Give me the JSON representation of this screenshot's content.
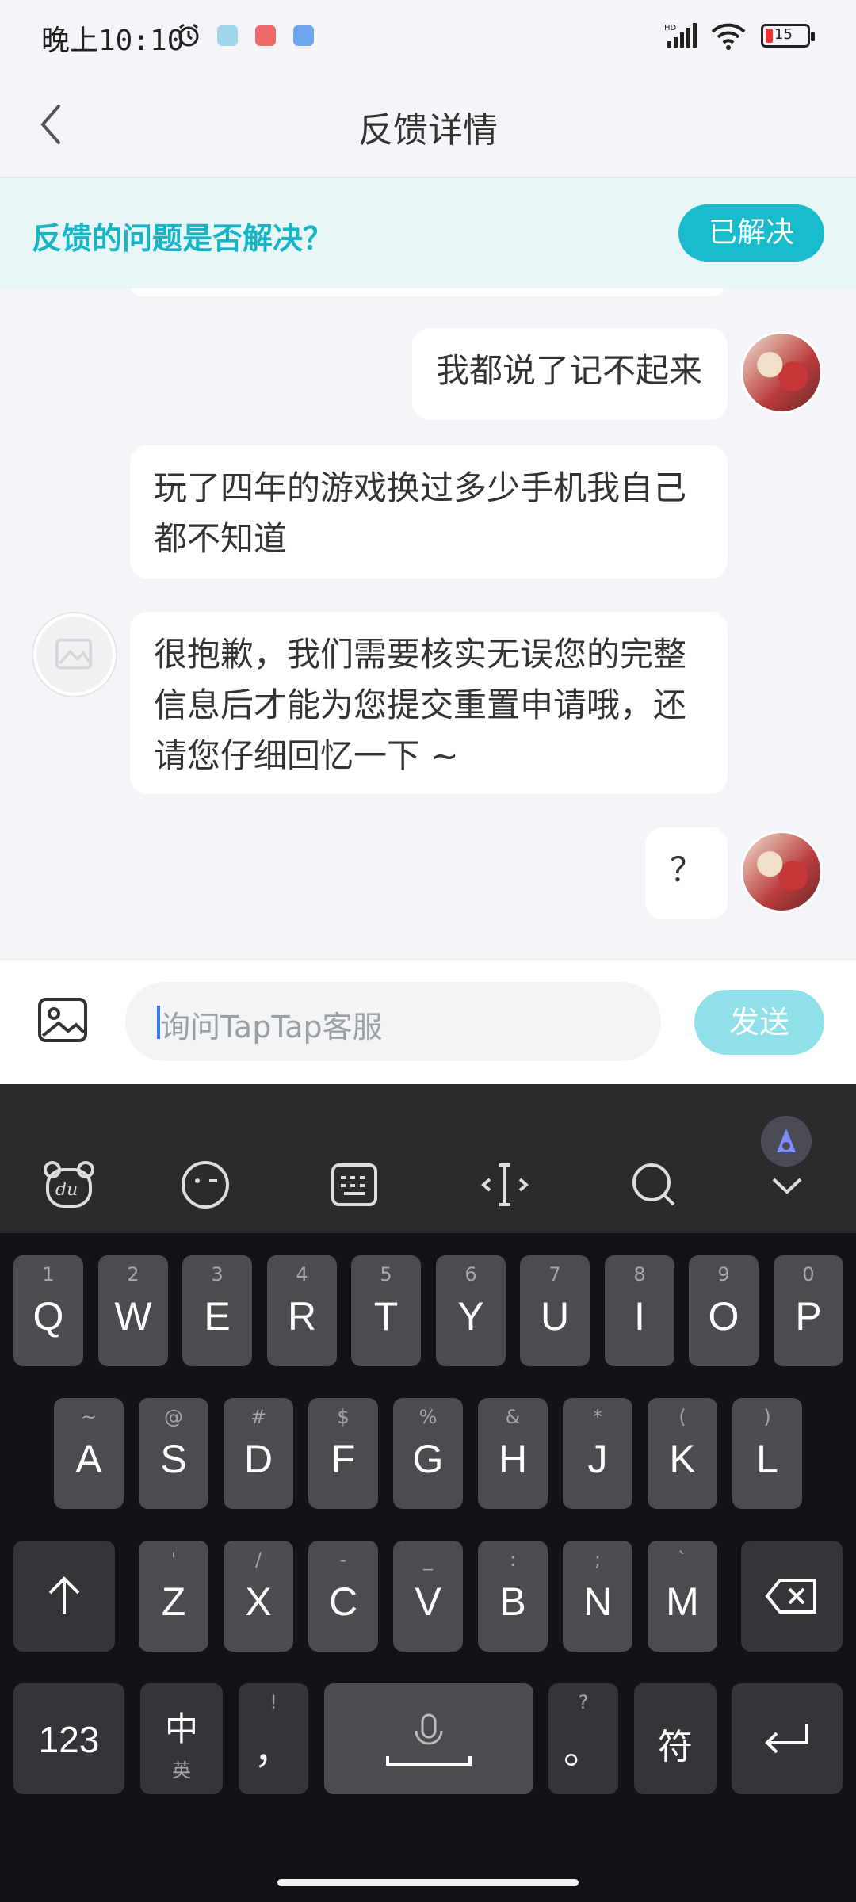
{
  "status_bar": {
    "time": "晚上10:10",
    "battery": "15"
  },
  "header": {
    "title": "反馈详情"
  },
  "banner": {
    "question": "反馈的问题是否解决？",
    "button": "已解决"
  },
  "messages": [
    {
      "from": "user",
      "text": "我都说了记不起来"
    },
    {
      "from": "support",
      "lines": [
        "玩了四年的游戏换过多少手机我自己",
        "都不知道"
      ]
    },
    {
      "from": "support",
      "lines": [
        "很抱歉，我们需要核实无误您的完整",
        "信息后才能为您提交重置申请哦，还",
        "请您仔细回忆一下 ~"
      ]
    },
    {
      "from": "user",
      "text": "？"
    }
  ],
  "input": {
    "placeholder": "询问TapTap客服",
    "send": "发送"
  },
  "keyboard": {
    "toolbar_icons": [
      "du-bear-icon",
      "emoji-icon",
      "keyboard-icon",
      "cursor-move-icon",
      "search-icon",
      "collapse-icon"
    ],
    "row1": [
      {
        "k": "Q",
        "s": "1"
      },
      {
        "k": "W",
        "s": "2"
      },
      {
        "k": "E",
        "s": "3"
      },
      {
        "k": "R",
        "s": "4"
      },
      {
        "k": "T",
        "s": "5"
      },
      {
        "k": "Y",
        "s": "6"
      },
      {
        "k": "U",
        "s": "7"
      },
      {
        "k": "I",
        "s": "8"
      },
      {
        "k": "O",
        "s": "9"
      },
      {
        "k": "P",
        "s": "0"
      }
    ],
    "row2": [
      {
        "k": "A",
        "s": "~"
      },
      {
        "k": "S",
        "s": "@"
      },
      {
        "k": "D",
        "s": "#"
      },
      {
        "k": "F",
        "s": "$"
      },
      {
        "k": "G",
        "s": "%"
      },
      {
        "k": "H",
        "s": "&"
      },
      {
        "k": "J",
        "s": "*"
      },
      {
        "k": "K",
        "s": "("
      },
      {
        "k": "L",
        "s": ")"
      }
    ],
    "row3": [
      {
        "k": "Z",
        "s": "'"
      },
      {
        "k": "X",
        "s": "/"
      },
      {
        "k": "C",
        "s": "-"
      },
      {
        "k": "V",
        "s": "_"
      },
      {
        "k": "B",
        "s": ":"
      },
      {
        "k": "N",
        "s": ";"
      },
      {
        "k": "M",
        "s": "`"
      }
    ],
    "numbers_key": "123",
    "lang_key": "中",
    "lang_sub": "英",
    "comma_key": "，",
    "comma_sub": "!",
    "period_key": "。",
    "period_sub": "?",
    "symbol_key": "符"
  }
}
